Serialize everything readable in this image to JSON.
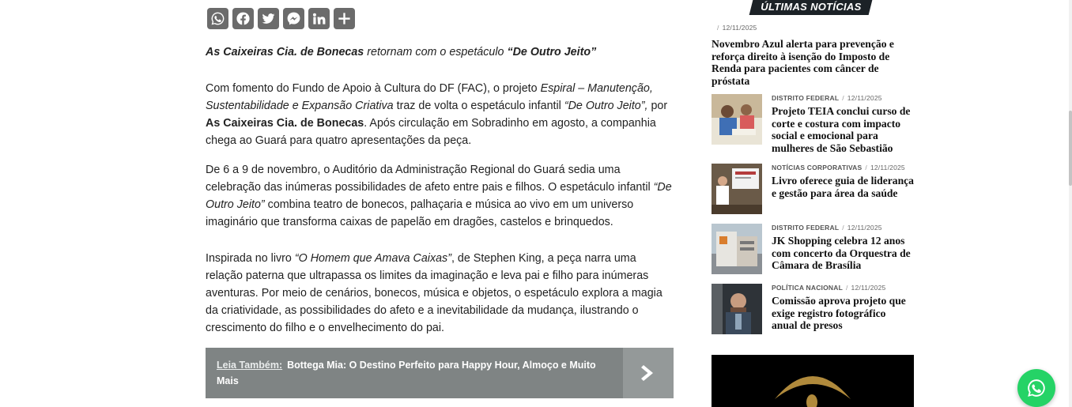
{
  "share": {
    "icons": [
      "whatsapp-icon",
      "facebook-icon",
      "twitter-icon",
      "messenger-icon",
      "linkedin-icon",
      "share-icon"
    ]
  },
  "article": {
    "lead": {
      "company": "As Caixeiras Cia. de Bonecas",
      "middle": " retornam com o espetáculo ",
      "show": "“De Outro Jeito”"
    },
    "p1": {
      "t1": "Com fomento do Fundo de Apoio à Cultura do DF (FAC), o projeto ",
      "project": "Espiral – Manutenção, Sustentabilidade e Expansão Criativa",
      "t2": " traz de volta o espetáculo infantil ",
      "show": "“De Outro Jeito”,",
      "t3": " por ",
      "company": "As Caixeiras Cia. de Bonecas",
      "t4": ". Após circulação em Sobradinho em agosto, a companhia chega ao Guará para quatro apresentações da peça."
    },
    "p2": {
      "t1": "De 6 a 9 de novembro, o Auditório da Administração Regional do Guará sedia uma celebração das inúmeras possibilidades de afeto entre pais e filhos. O espetáculo infantil ",
      "show": "“De Outro Jeito”",
      "t2": " combina teatro de bonecos, palhaçaria e música ao vivo em um universo imaginário que transforma caixas de papelão em dragões, castelos e brinquedos."
    },
    "p3": {
      "t1": "Inspirada no livro ",
      "book": "“O Homem que Amava Caixas”",
      "t2": ", de Stephen King, a peça narra uma relação paterna que ultrapassa os limites da imaginação e leva pai e filho para inúmeras aventuras. Por meio de cenários, bonecos, música e objetos, o espetáculo explora a magia da criatividade, as possibilidades do afeto e a inevitabilidade da mudança, ilustrando o crescimento do filho e o envelhecimento do pai."
    },
    "also": {
      "label": "Leia Também:",
      "title": "Bottega Mia: O Destino Perfeito para Happy Hour, Almoço e Muito Mais"
    }
  },
  "sidebar": {
    "heading": "ÚLTIMAS NOTÍCIAS",
    "first": {
      "sep": "/",
      "date": "12/11/2025",
      "title": "Novembro Azul alerta para prevenção e reforça direito à isenção do Imposto de Renda para pacientes com câncer de próstata"
    },
    "items": [
      {
        "category": "DISTRITO FEDERAL",
        "sep": "/",
        "date": "12/11/2025",
        "title": "Projeto TEIA conclui curso de corte e costura com impacto social e emocional para mulheres de São Sebastião"
      },
      {
        "category": "NOTÍCIAS CORPORATIVAS",
        "sep": "/",
        "date": "12/11/2025",
        "title": "Livro oferece guia de liderança e gestão para área da saúde"
      },
      {
        "category": "DISTRITO FEDERAL",
        "sep": "/",
        "date": "12/11/2025",
        "title": "JK Shopping celebra 12 anos com concerto da Orquestra de Câmara de Brasília"
      },
      {
        "category": "POLÍTICA NACIONAL",
        "sep": "/",
        "date": "12/11/2025",
        "title": "Comissão aprova projeto que exige registro fotográfico anual de presos"
      }
    ]
  },
  "colors": {
    "share_bg": "#6b6b6b",
    "also_bg": "#7f8484",
    "heading_bg": "#1c2227",
    "whatsapp": "#25d366"
  }
}
